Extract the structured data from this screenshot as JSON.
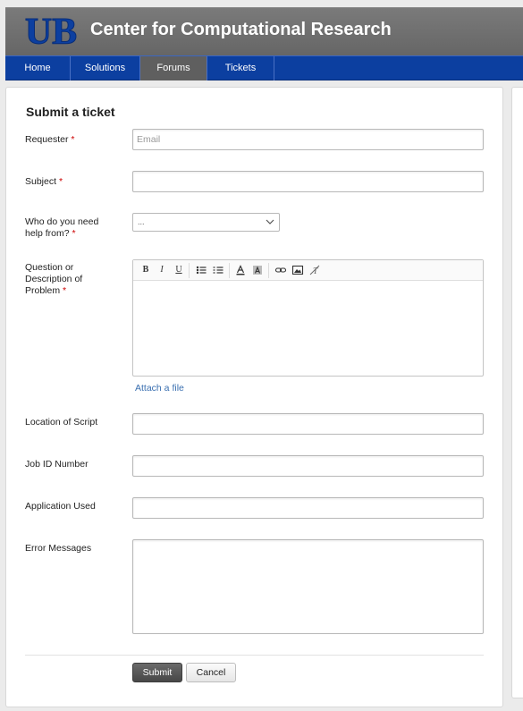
{
  "header": {
    "title": "Center for Computational Research",
    "logo_text": "UB",
    "logo_color": "#0c3fa0"
  },
  "nav": {
    "items": [
      {
        "label": "Home",
        "active": false
      },
      {
        "label": "Solutions",
        "active": false
      },
      {
        "label": "Forums",
        "active": true
      },
      {
        "label": "Tickets",
        "active": false
      }
    ]
  },
  "form": {
    "title": "Submit a ticket",
    "required_marker": "*",
    "requester": {
      "label": "Requester",
      "placeholder": "Email",
      "value": ""
    },
    "subject": {
      "label": "Subject",
      "value": ""
    },
    "who": {
      "label": "Who do you need help from?",
      "selected": "..."
    },
    "question": {
      "label": "Question or Description of Problem",
      "value": ""
    },
    "editor_toolbar": [
      "bold-icon",
      "italic-icon",
      "underline-icon",
      "bulleted-list-icon",
      "numbered-list-icon",
      "font-color-icon",
      "background-color-icon",
      "link-icon",
      "image-icon",
      "remove-format-icon"
    ],
    "attach_label": "Attach a file",
    "location_of_script": {
      "label": "Location of Script",
      "value": ""
    },
    "job_id": {
      "label": "Job ID Number",
      "value": ""
    },
    "application_used": {
      "label": "Application Used",
      "value": ""
    },
    "error_messages": {
      "label": "Error Messages",
      "value": ""
    },
    "submit_label": "Submit",
    "cancel_label": "Cancel"
  }
}
